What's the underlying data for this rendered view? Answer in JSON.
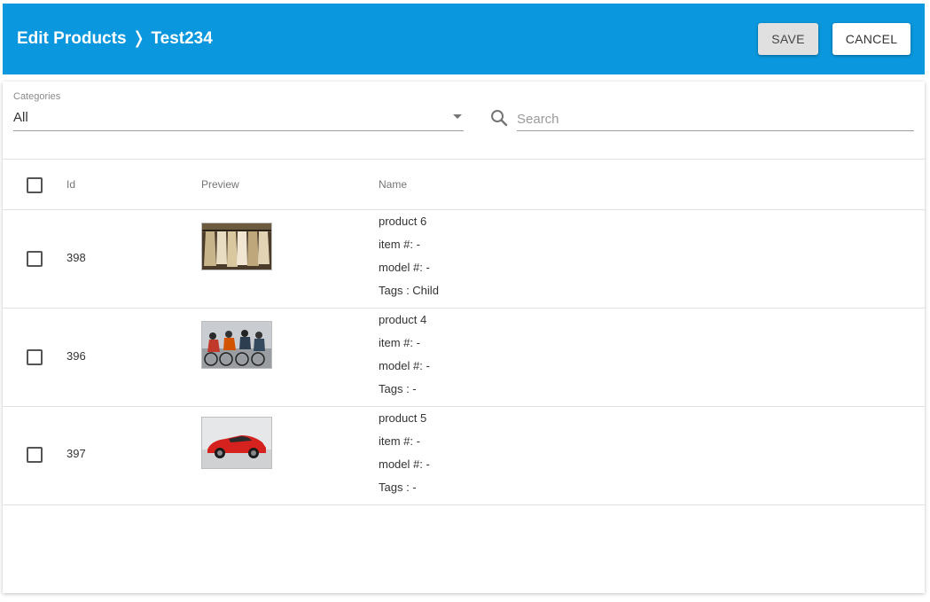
{
  "header": {
    "title_prefix": "Edit Products",
    "separator": "❭",
    "title_suffix": "Test234",
    "save_label": "SAVE",
    "cancel_label": "CANCEL",
    "accent_color": "#0a97dd"
  },
  "filters": {
    "category_label": "Categories",
    "category_value": "All",
    "search_placeholder": "Search",
    "search_value": ""
  },
  "table": {
    "columns": {
      "id": "Id",
      "preview": "Preview",
      "name": "Name"
    },
    "rows": [
      {
        "id": "398",
        "preview_icon": "clothes-rack-image",
        "name": "product 6",
        "item": "item #: -",
        "model": "model #: -",
        "tags": "Tags : Child",
        "checked": false
      },
      {
        "id": "396",
        "preview_icon": "cyclists-image",
        "name": "product 4",
        "item": "item #: -",
        "model": "model #: -",
        "tags": "Tags : -",
        "checked": false
      },
      {
        "id": "397",
        "preview_icon": "red-sports-car-image",
        "name": "product 5",
        "item": "item #: -",
        "model": "model #: -",
        "tags": "Tags : -",
        "checked": false
      }
    ]
  }
}
